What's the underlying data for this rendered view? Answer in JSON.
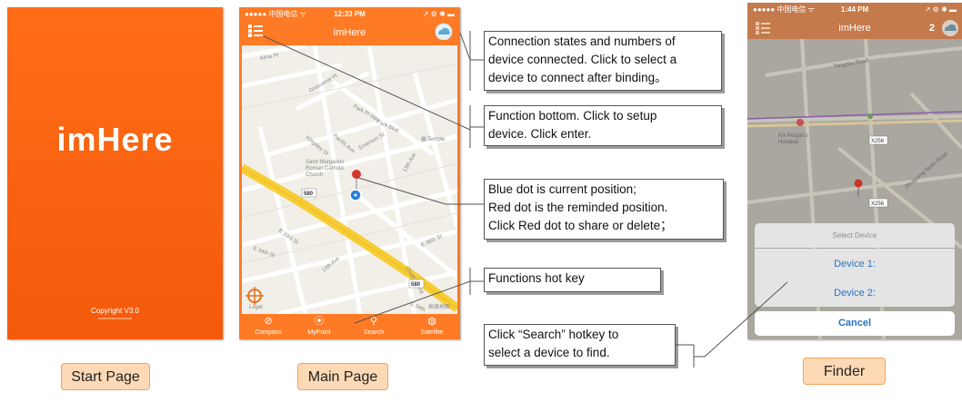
{
  "start_page": {
    "logo": "imHere",
    "copyright": "Copyright V3.0"
  },
  "main_page": {
    "status": {
      "carrier": "●●●●● 中国电信 ᯤ",
      "time": "12:33 PM",
      "right": "↗ ⚙ ✱ ▬"
    },
    "title": "imHere",
    "map_labels": {
      "alma": "Alma Pl",
      "grosvenor": "Grosvenor Pl",
      "park_pl_way": "Park Pl Way",
      "park_blvd": "Park Blvd",
      "temple": "Temple",
      "kingsley": "Kingsley St",
      "paceblvd": "Pacific Ave",
      "emerson": "Emerson St",
      "church": "Saint Margarets\nRoman Catholic\nChurch",
      "i580a": "580",
      "i580b": "580",
      "e34th": "E 34th St",
      "e33rd": "E 33rd St",
      "th13": "13th Ave",
      "e36th": "E 36th St",
      "chatham": "Chatham Rd",
      "e34": "E 34th",
      "legal": "Legal",
      "watermark": "高德地图"
    },
    "tabs": [
      {
        "label": "Compass",
        "icon": "compass-icon"
      },
      {
        "label": "MyPoint",
        "icon": "location-pin-icon"
      },
      {
        "label": "Search",
        "icon": "search-icon"
      },
      {
        "label": "Satellite",
        "icon": "globe-icon"
      }
    ]
  },
  "finder_page": {
    "status": {
      "carrier": "●●●●● 中国电信 ᯤ",
      "time": "1:44 PM",
      "right": "↗ ⚙ ✱ ▬"
    },
    "title": "imHere",
    "badge": "2",
    "map_labels": {
      "tongzhu": "Tongzhu Road",
      "hospital": "Kili People's\nHospital",
      "x256a": "X256",
      "x256b": "X256",
      "zhuguang": "Zhuguang North Road"
    },
    "sheet": {
      "title": "Select Device",
      "device1": "Device 1:",
      "device2": "Device 2:",
      "cancel": "Cancel"
    }
  },
  "callouts": {
    "connection": [
      "Connection states and numbers of",
      "device connected. Click to select a",
      "device to connect after binding。"
    ],
    "function": [
      "Function bottom. Click to setup",
      "device. Click enter."
    ],
    "dots": [
      "Blue dot is current position;",
      "Red dot is the reminded position.",
      "Click Red dot to share or delete；"
    ],
    "hotkey": [
      "Functions hot key"
    ],
    "search": [
      "Click “Search” hotkey to",
      "select a device to find."
    ]
  },
  "labels": {
    "start": "Start Page",
    "main": "Main Page",
    "finder": "Finder"
  },
  "colors": {
    "orange": "#ff7a24",
    "start_orange": "#f45a0b",
    "label_fill": "#fdd9b5",
    "label_border": "#f3a25a",
    "ios_blue": "#2a75c4",
    "pin_red": "#d9342b",
    "pin_blue": "#2a7fd8"
  }
}
